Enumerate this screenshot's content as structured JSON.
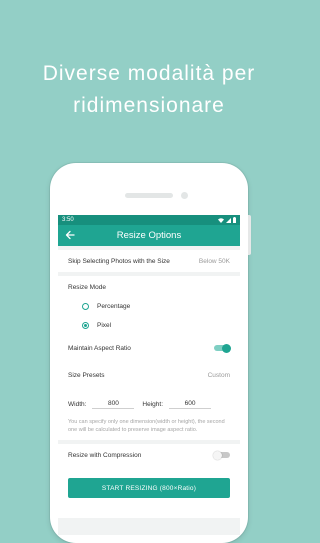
{
  "promo": {
    "line1": "Diverse modalità per",
    "line2": "ridimensionare"
  },
  "status_bar": {
    "time": "3:50",
    "icons": [
      "wifi-icon",
      "signal-icon",
      "battery-icon"
    ]
  },
  "app_bar": {
    "title": "Resize Options",
    "back_icon": "arrow-left-icon"
  },
  "skip": {
    "label": "Skip Selecting Photos with the Size",
    "value": "Below 50K"
  },
  "resize_mode": {
    "label": "Resize Mode",
    "options": [
      {
        "label": "Percentage",
        "selected": false
      },
      {
        "label": "Pixel",
        "selected": true
      }
    ]
  },
  "aspect": {
    "label": "Maintain Aspect Ratio",
    "on": true
  },
  "presets": {
    "label": "Size Presets",
    "value": "Custom"
  },
  "dimensions": {
    "width_label": "Width:",
    "width_value": "800",
    "height_label": "Height:",
    "height_value": "600"
  },
  "note": "You can specify only one dimension(width or height), the second one will be calculated to preserve image aspect ratio.",
  "compression": {
    "label": "Resize with Compression",
    "on": false
  },
  "start_button": "START RESIZING (800×Ratio)",
  "colors": {
    "background": "#93cfc6",
    "primary": "#1fa592",
    "primary_dark": "#178f7d"
  }
}
